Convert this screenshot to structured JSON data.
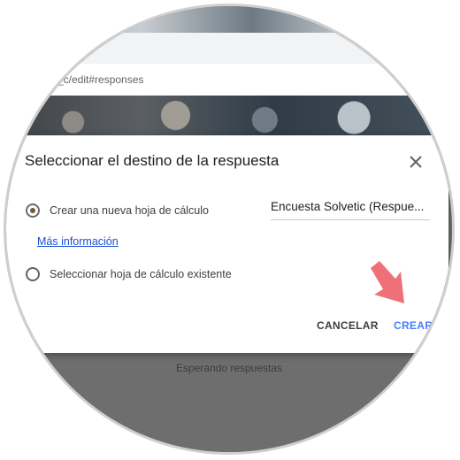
{
  "browser": {
    "url_fragment": "_c/edit#responses"
  },
  "page": {
    "waiting_text": "Esperando respuestas"
  },
  "dialog": {
    "title": "Seleccionar el destino de la respuesta",
    "close_icon": "close-icon",
    "option_new": {
      "label": "Crear una nueva hoja de cálculo",
      "selected": true,
      "spreadsheet_name": "Encuesta Solvetic (Respue..."
    },
    "more_info_link": "Más información",
    "option_existing": {
      "label": "Seleccionar hoja de cálculo existente",
      "selected": false
    },
    "buttons": {
      "cancel": "CANCELAR",
      "create": "CREAR"
    }
  },
  "colors": {
    "accent_link": "#1a4fd6",
    "create_button": "#4a7cff",
    "annotation_arrow": "#f0707a"
  }
}
